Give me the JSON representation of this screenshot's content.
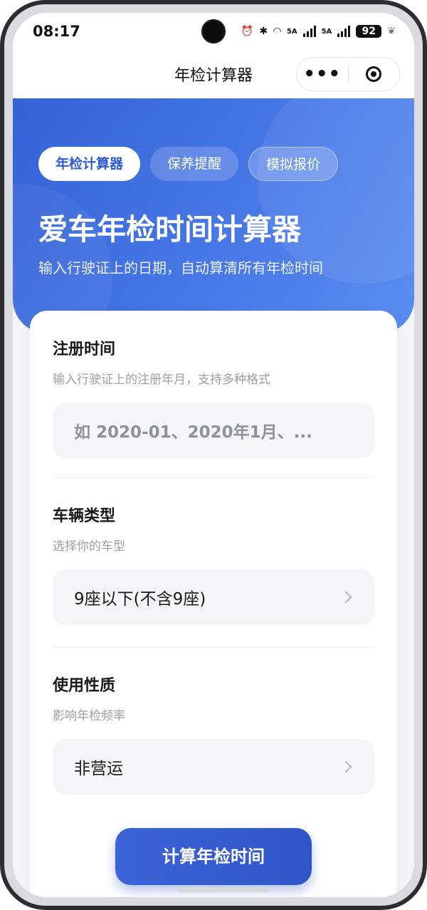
{
  "status_bar": {
    "time": "08:17",
    "network_1": "5A",
    "network_2": "5A",
    "battery": "92",
    "icons": [
      "alarm-icon",
      "bluetooth-icon",
      "wifi-icon",
      "signal-icon",
      "leaf-icon"
    ]
  },
  "nav": {
    "title": "年检计算器",
    "more_icon": "more-dots-icon",
    "close_icon": "capsule-close-icon"
  },
  "hero": {
    "tabs": [
      {
        "label": "年检计算器",
        "active": true
      },
      {
        "label": "保养提醒",
        "active": false
      },
      {
        "label": "模拟报价",
        "active": false
      }
    ],
    "title": "爱车年检时间计算器",
    "subtitle": "输入行驶证上的日期，自动算清所有年检时间"
  },
  "form": {
    "register": {
      "label": "注册时间",
      "hint": "输入行驶证上的注册年月，支持多种格式",
      "placeholder": "如 2020-01、2020年1月、..."
    },
    "vehicle_type": {
      "label": "车辆类型",
      "hint": "选择你的车型",
      "value": "9座以下(不含9座)"
    },
    "usage": {
      "label": "使用性质",
      "hint": "影响年检频率",
      "value": "非营运"
    },
    "submit_label": "计算年检时间"
  },
  "colors": {
    "primary": "#3562d6",
    "background": "#f3f5f9"
  }
}
